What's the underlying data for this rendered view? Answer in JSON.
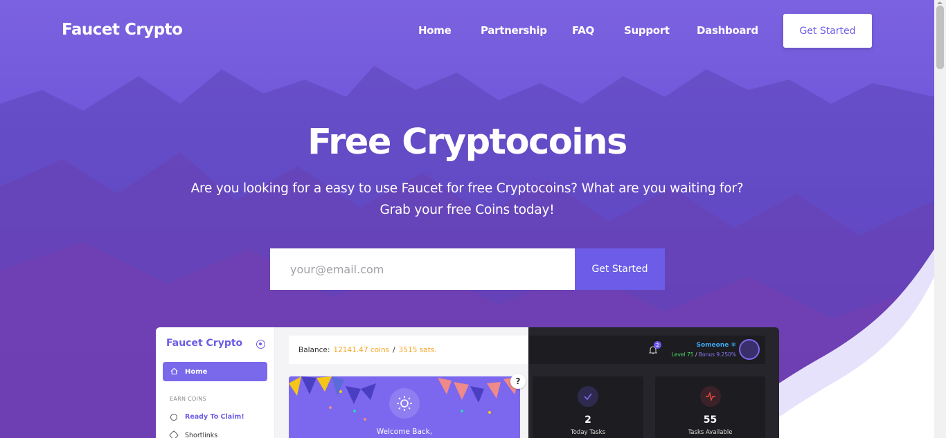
{
  "nav": {
    "brand": "Faucet Crypto",
    "items": [
      {
        "label": "Home"
      },
      {
        "label": "Partnership"
      },
      {
        "label": "FAQ"
      },
      {
        "label": "Support"
      },
      {
        "label": "Dashboard"
      }
    ],
    "cta": "Get Started"
  },
  "hero": {
    "title": "Free Cryptocoins",
    "subtitle_line1": "Are you looking for a easy to use Faucet for free Cryptocoins? What are you waiting for?",
    "subtitle_line2": "Grab your free Coins today!",
    "email_placeholder": "your@email.com",
    "signup_button": "Get Started"
  },
  "preview": {
    "brand": "Faucet Crypto",
    "home_label": "Home",
    "section_label": "EARN COINS",
    "links": [
      {
        "label": "Ready To Claim!",
        "color": "#6c5ce7"
      },
      {
        "label": "Shortlinks",
        "color": "#333333"
      }
    ],
    "balance_label": "Balance:",
    "balance_coins": "12141.47 coins",
    "balance_sep": "/",
    "balance_sats": "3515 sats.",
    "welcome_text": "Welcome Back,",
    "help_label": "?",
    "bell_count": "2",
    "username": "Someone ❄",
    "level": "Level 75",
    "level_sep": "/",
    "bonus": "Bonus 9.250%",
    "cards": [
      {
        "value": "2",
        "label": "Today Tasks",
        "icon": "check-icon",
        "color": "#6c5ce7"
      },
      {
        "value": "55",
        "label": "Tasks Available",
        "icon": "pulse-icon",
        "color": "#e74c3c"
      }
    ]
  },
  "colors": {
    "accent": "#6c5ce7",
    "hero_bg": "#6d55d9",
    "balance_highlight": "#f5a623"
  }
}
